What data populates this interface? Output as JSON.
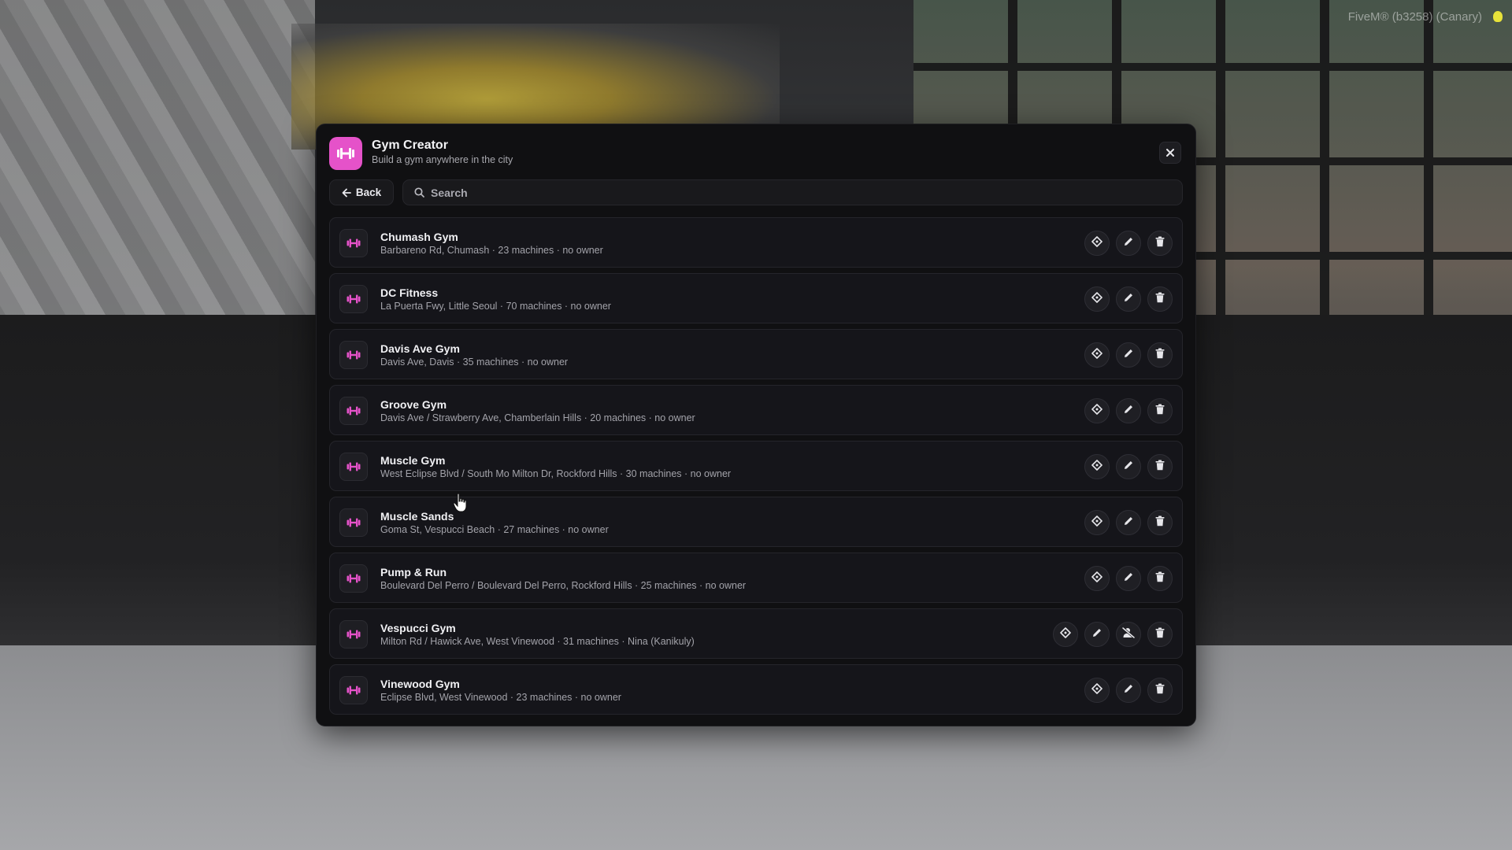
{
  "overlay": {
    "watermark": "FiveM® (b3258) (Canary)"
  },
  "header": {
    "title": "Gym Creator",
    "subtitle": "Build a gym anywhere in the city",
    "app_icon": "dumbbell-icon",
    "close_icon": "close-icon"
  },
  "toolbar": {
    "back_label": "Back",
    "search_placeholder": "Search",
    "search_value": ""
  },
  "colors": {
    "accent": "#e552c9",
    "panel_bg": "#101012",
    "row_bg": "#15151a"
  },
  "gyms": [
    {
      "name": "Chumash Gym",
      "meta": "Barbareno Rd, Chumash · 23 machines · no owner",
      "owned": false
    },
    {
      "name": "DC Fitness",
      "meta": "La Puerta Fwy, Little Seoul · 70 machines · no owner",
      "owned": false
    },
    {
      "name": "Davis Ave Gym",
      "meta": "Davis Ave, Davis · 35 machines · no owner",
      "owned": false
    },
    {
      "name": "Groove Gym",
      "meta": "Davis Ave / Strawberry Ave, Chamberlain Hills · 20 machines · no owner",
      "owned": false
    },
    {
      "name": "Muscle Gym",
      "meta": "West Eclipse Blvd / South Mo Milton Dr, Rockford Hills · 30 machines · no owner",
      "owned": false
    },
    {
      "name": "Muscle Sands",
      "meta": "Goma St, Vespucci Beach · 27 machines · no owner",
      "owned": false
    },
    {
      "name": "Pump & Run",
      "meta": "Boulevard Del Perro / Boulevard Del Perro, Rockford Hills · 25 machines · no owner",
      "owned": false
    },
    {
      "name": "Vespucci Gym",
      "meta": "Milton Rd / Hawick Ave, West Vinewood · 31 machines · Nina (Kanikuly)",
      "owned": true
    },
    {
      "name": "Vinewood Gym",
      "meta": "Eclipse Blvd, West Vinewood · 23 machines · no owner",
      "owned": false
    }
  ]
}
